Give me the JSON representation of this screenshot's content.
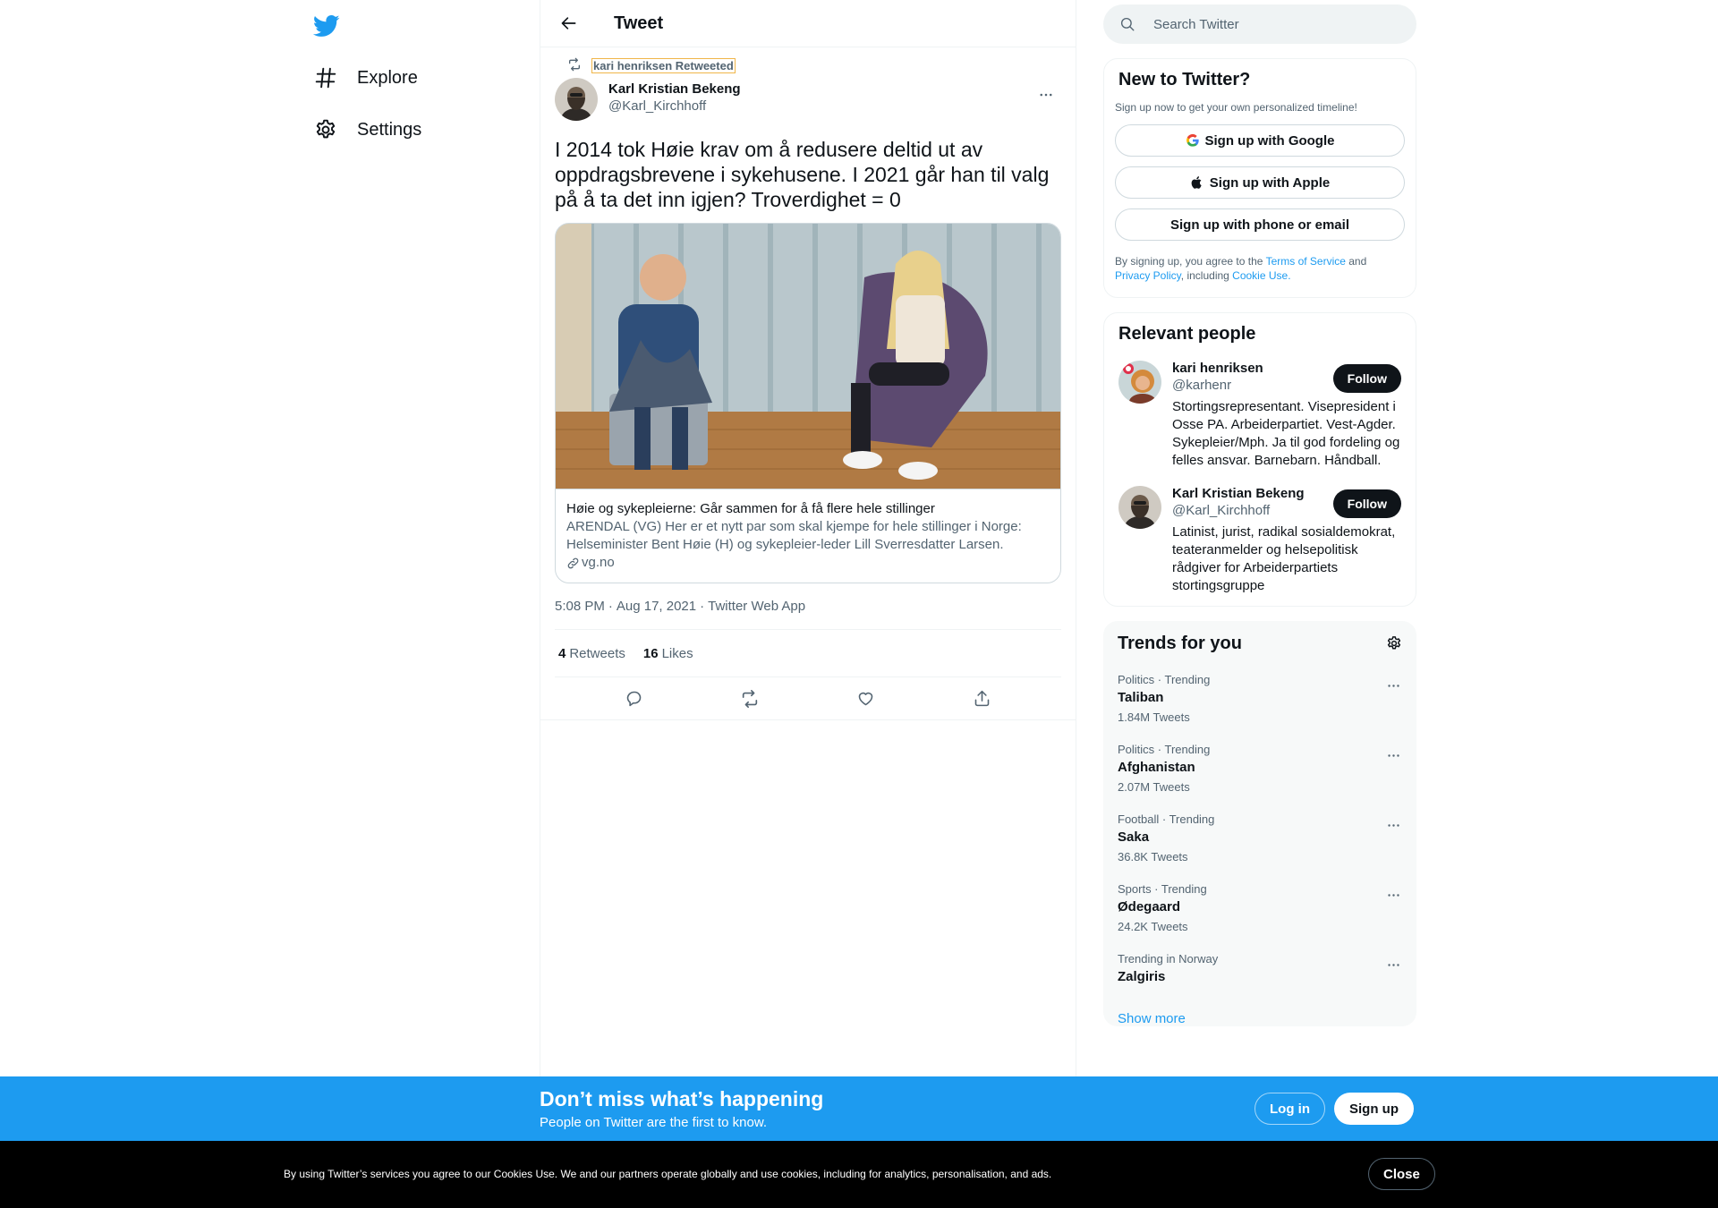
{
  "colors": {
    "accent": "#1d9bf0",
    "text": "#0f1419",
    "muted": "#536471",
    "border": "#eff3f4",
    "dark": "#000000"
  },
  "nav": {
    "logo_icon": "twitter-bird-icon",
    "items": [
      {
        "label": "Explore",
        "icon": "hashtag-icon"
      },
      {
        "label": "Settings",
        "icon": "gear-icon"
      }
    ]
  },
  "header": {
    "title": "Tweet",
    "back_icon": "back-arrow-icon"
  },
  "tweet": {
    "retweeted_by": "kari henriksen Retweeted",
    "author": {
      "name": "Karl Kristian Bekeng",
      "handle": "@Karl_Kirchhoff"
    },
    "text": "I 2014 tok Høie krav om å redusere deltid ut av\noppdragsbrevene i sykehusene. I 2021 går han til valg\npå å ta det inn igjen? Troverdighet = 0",
    "card": {
      "title": "Høie og sykepleierne: Går sammen for å få flere hele stillinger",
      "description": "ARENDAL (VG) Her er et nytt par som skal kjempe for hele stillinger i Norge: Helseminister Bent Høie (H) og sykepleier-leder Lill Sverresdatter Larsen.",
      "domain": "vg.no"
    },
    "meta": {
      "time": "5:08 PM",
      "date": "Aug 17, 2021",
      "source": "Twitter Web App",
      "separator": "·"
    },
    "stats": {
      "retweets_count": "4",
      "retweets_label": "Retweets",
      "likes_count": "16",
      "likes_label": "Likes"
    }
  },
  "search": {
    "placeholder": "Search Twitter"
  },
  "new_to_twitter": {
    "title": "New to Twitter?",
    "subtitle": "Sign up now to get your own personalized timeline!",
    "google": "Sign up with Google",
    "apple": "Sign up with Apple",
    "phone": "Sign up with phone or email",
    "legal_1": "By signing up, you agree to the ",
    "terms": "Terms of Service",
    "legal_2": " and ",
    "privacy": "Privacy Policy",
    "legal_3": ", including ",
    "cookie": "Cookie Use."
  },
  "relevant": {
    "title": "Relevant people",
    "people": [
      {
        "name": "kari henriksen",
        "handle": "@karhenr",
        "bio": "Stortingsrepresentant. Visepresident i Osse PA. Arbeiderpartiet. Vest-Agder. Sykepleier/Mph. Ja til god fordeling og felles ansvar. Barnebarn. Håndball.",
        "follow": "Follow"
      },
      {
        "name": "Karl Kristian Bekeng",
        "handle": "@Karl_Kirchhoff",
        "bio": "Latinist, jurist, radikal sosialdemokrat, teateranmelder og helsepolitisk rådgiver for Arbeiderpartiets stortingsgruppe",
        "follow": "Follow"
      }
    ]
  },
  "trends": {
    "title": "Trends for you",
    "items": [
      {
        "meta": "Politics · Trending",
        "name": "Taliban",
        "count": "1.84M Tweets"
      },
      {
        "meta": "Politics · Trending",
        "name": "Afghanistan",
        "count": "2.07M Tweets"
      },
      {
        "meta": "Football · Trending",
        "name": "Saka",
        "count": "36.8K Tweets"
      },
      {
        "meta": "Sports · Trending",
        "name": "Ødegaard",
        "count": "24.2K Tweets"
      },
      {
        "meta": "Trending in Norway",
        "name": "Zalgiris",
        "count": ""
      }
    ],
    "show_more": "Show more"
  },
  "banner": {
    "title": "Don’t miss what’s happening",
    "subtitle": "People on Twitter are the first to know.",
    "login": "Log in",
    "signup": "Sign up"
  },
  "cookie_bar": {
    "text": "By using Twitter’s services you agree to our Cookies Use. We and our partners operate globally and use cookies, including for analytics, personalisation, and ads.",
    "close": "Close"
  }
}
